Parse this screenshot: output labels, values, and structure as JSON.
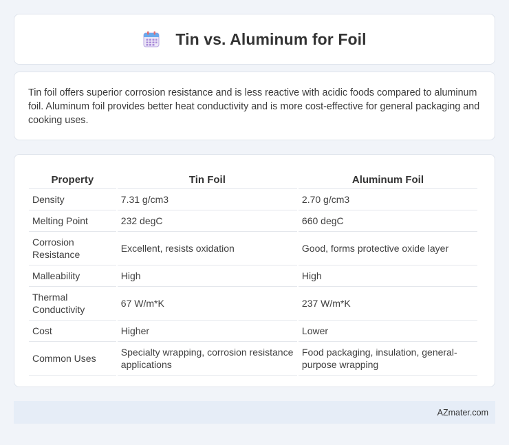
{
  "header": {
    "title": "Tin vs. Aluminum for Foil",
    "icon": "calendar-icon"
  },
  "summary": {
    "text": "Tin foil offers superior corrosion resistance and is less reactive with acidic foods compared to aluminum foil. Aluminum foil provides better heat conductivity and is more cost-effective for general packaging and cooking uses."
  },
  "table": {
    "headers": [
      "Property",
      "Tin Foil",
      "Aluminum Foil"
    ],
    "rows": [
      [
        "Density",
        "7.31 g/cm3",
        "2.70 g/cm3"
      ],
      [
        "Melting Point",
        "232 degC",
        "660 degC"
      ],
      [
        "Corrosion Resistance",
        "Excellent, resists oxidation",
        "Good, forms protective oxide layer"
      ],
      [
        "Malleability",
        "High",
        "High"
      ],
      [
        "Thermal Conductivity",
        "67 W/m*K",
        "237 W/m*K"
      ],
      [
        "Cost",
        "Higher",
        "Lower"
      ],
      [
        "Common Uses",
        "Specialty wrapping, corrosion resistance applications",
        "Food packaging, insulation, general-purpose wrapping"
      ]
    ]
  },
  "footer": {
    "text": "AZmater.com"
  }
}
